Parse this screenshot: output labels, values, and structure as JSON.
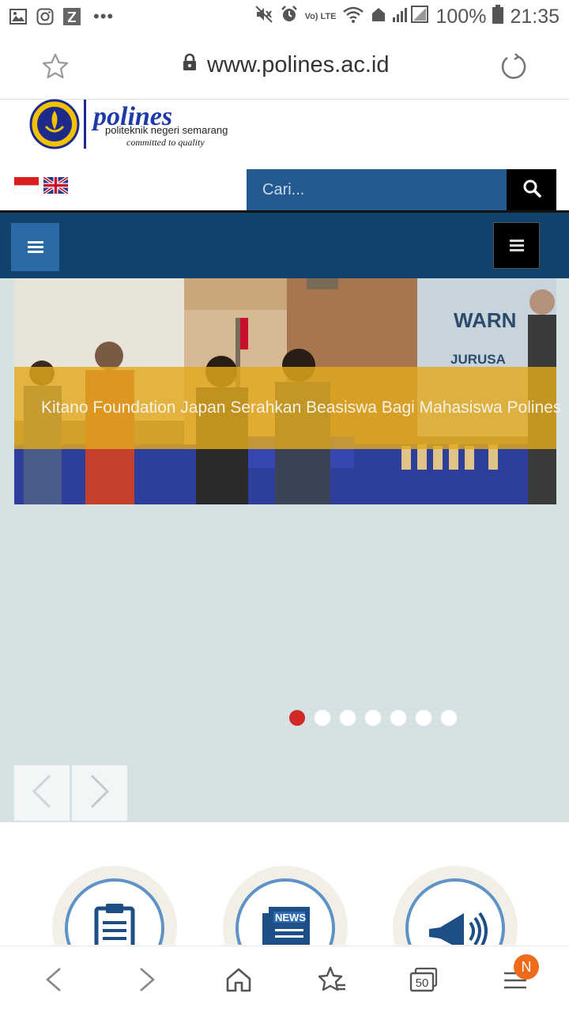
{
  "status_bar": {
    "battery": "100%",
    "time": "21:35",
    "network": "Vo) LTE",
    "icons_left": [
      "image-icon",
      "instagram-icon",
      "z-app-icon",
      "more-dots-icon"
    ],
    "icons_right": [
      "mute-icon",
      "alarm-icon",
      "volte-icon",
      "wifi-icon",
      "signal-icon",
      "battery-icon"
    ]
  },
  "browser": {
    "url": "www.polines.ac.id",
    "tab_count": "50",
    "notification_badge": "N"
  },
  "site": {
    "logo_name": "polines",
    "logo_subtitle": "politeknik negeri semarang",
    "logo_tagline": "committed to quality",
    "search_placeholder": "Cari...",
    "languages": [
      "id-flag",
      "uk-flag"
    ]
  },
  "slider": {
    "caption": "Kitano Foundation Japan Serahkan Beasiswa Bagi Mahasiswa Polines",
    "slide_count": 7,
    "active_index": 0,
    "banner_text_1": "WARN",
    "banner_text_2": "JURUSA"
  },
  "features": {
    "items": [
      "clipboard-icon",
      "news-icon",
      "megaphone-icon"
    ],
    "news_label": "NEWS"
  },
  "colors": {
    "nav_blue": "#10426c",
    "search_blue": "#245a90",
    "caption_gold": "#e2aa1c",
    "active_dot": "#d12a26",
    "badge_orange": "#f06a1c"
  }
}
